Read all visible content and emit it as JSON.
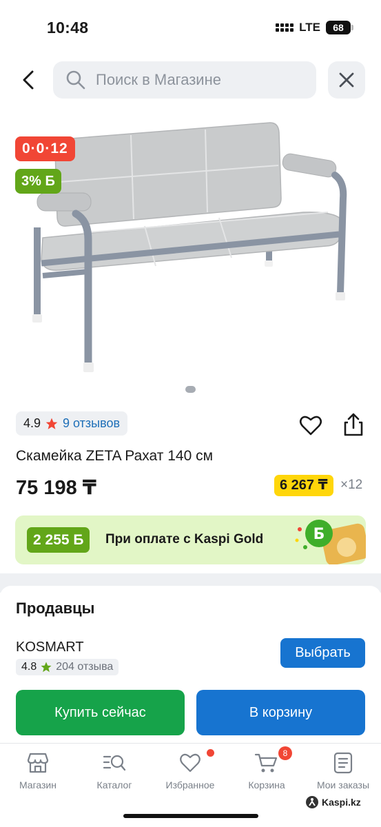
{
  "status_bar": {
    "time": "10:48",
    "network": "LTE",
    "battery": "68"
  },
  "search": {
    "placeholder": "Поиск в Магазине"
  },
  "product": {
    "promo_badge": "0·0·12",
    "bonus_badge": "3% Б",
    "rating": "4.9",
    "reviews": "9 отзывов",
    "title": "Скамейка ZETA Рахат 140 см",
    "price": "75 198 ₸",
    "installment_price": "6 267 ₸",
    "installment_months": "×12"
  },
  "gold_banner": {
    "bonus": "2 255 Б",
    "text": "При оплате с Kaspi Gold"
  },
  "sellers": {
    "title": "Продавцы",
    "items": [
      {
        "name": "KOSMART",
        "rating": "4.8",
        "reviews": "204 отзыва",
        "choose_label": "Выбрать"
      }
    ]
  },
  "actions": {
    "buy_now": "Купить сейчас",
    "add_to_cart": "В корзину"
  },
  "tab_bar": {
    "items": [
      {
        "label": "Магазин",
        "icon": "shop-icon"
      },
      {
        "label": "Каталог",
        "icon": "catalog-search-icon"
      },
      {
        "label": "Избранное",
        "icon": "heart-icon"
      },
      {
        "label": "Корзина",
        "icon": "cart-icon",
        "badge": "8"
      },
      {
        "label": "Мои заказы",
        "icon": "orders-icon"
      }
    ]
  },
  "watermark": "Kaspi.kz",
  "colors": {
    "kaspi_red": "#f14635",
    "bonus_green": "#62a619",
    "primary_blue": "#1774d0",
    "buy_green": "#16a34a",
    "installment_yellow": "#ffd60a"
  }
}
